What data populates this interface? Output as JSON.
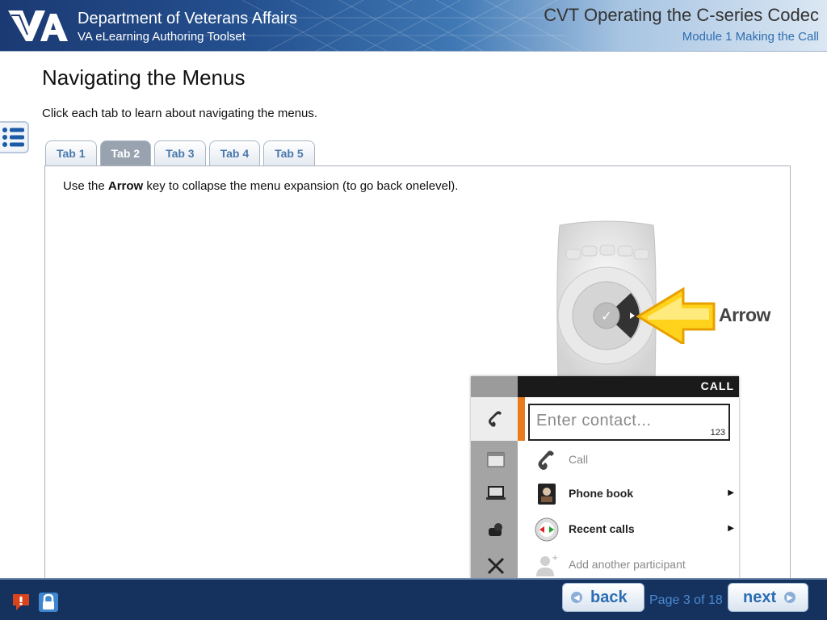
{
  "header": {
    "org_title": "Department of Veterans Affairs",
    "org_subtitle": "VA eLearning Authoring Toolset",
    "course_title": "CVT Operating the C-series Codec",
    "module_title": "Module 1 Making the Call"
  },
  "content": {
    "page_title": "Navigating the Menus",
    "instructions": "Click each tab to learn about navigating the menus.",
    "tabs": [
      {
        "label": "Tab 1",
        "active": false
      },
      {
        "label": "Tab 2",
        "active": true
      },
      {
        "label": "Tab 3",
        "active": false
      },
      {
        "label": "Tab 4",
        "active": false
      },
      {
        "label": "Tab 5",
        "active": false
      }
    ],
    "panel": {
      "text_before": "Use the ",
      "text_bold": "Arrow",
      "text_after": " key to collapse the menu expansion (to go back onelevel).",
      "arrow_label": "Arrow"
    },
    "screen": {
      "header": "CALL",
      "placeholder": "Enter contact...",
      "number_hint": "123",
      "items": [
        {
          "label": "Call",
          "icon": "handset-icon",
          "enabled": false,
          "submenu": false
        },
        {
          "label": "Phone book",
          "icon": "phonebook-icon",
          "enabled": true,
          "submenu": true
        },
        {
          "label": "Recent calls",
          "icon": "recent-calls-icon",
          "enabled": true,
          "submenu": true
        },
        {
          "label": "Add another participant",
          "icon": "add-participant-icon",
          "enabled": false,
          "submenu": false
        }
      ],
      "caret": "▶"
    }
  },
  "footer": {
    "back_label": "back",
    "next_label": "next",
    "page_indicator": "Page 3 of 18"
  },
  "colors": {
    "header_dark": "#1b3a73",
    "footer": "#15325f",
    "accent_blue": "#2d6db4",
    "orange_highlight": "#e87b1c"
  }
}
